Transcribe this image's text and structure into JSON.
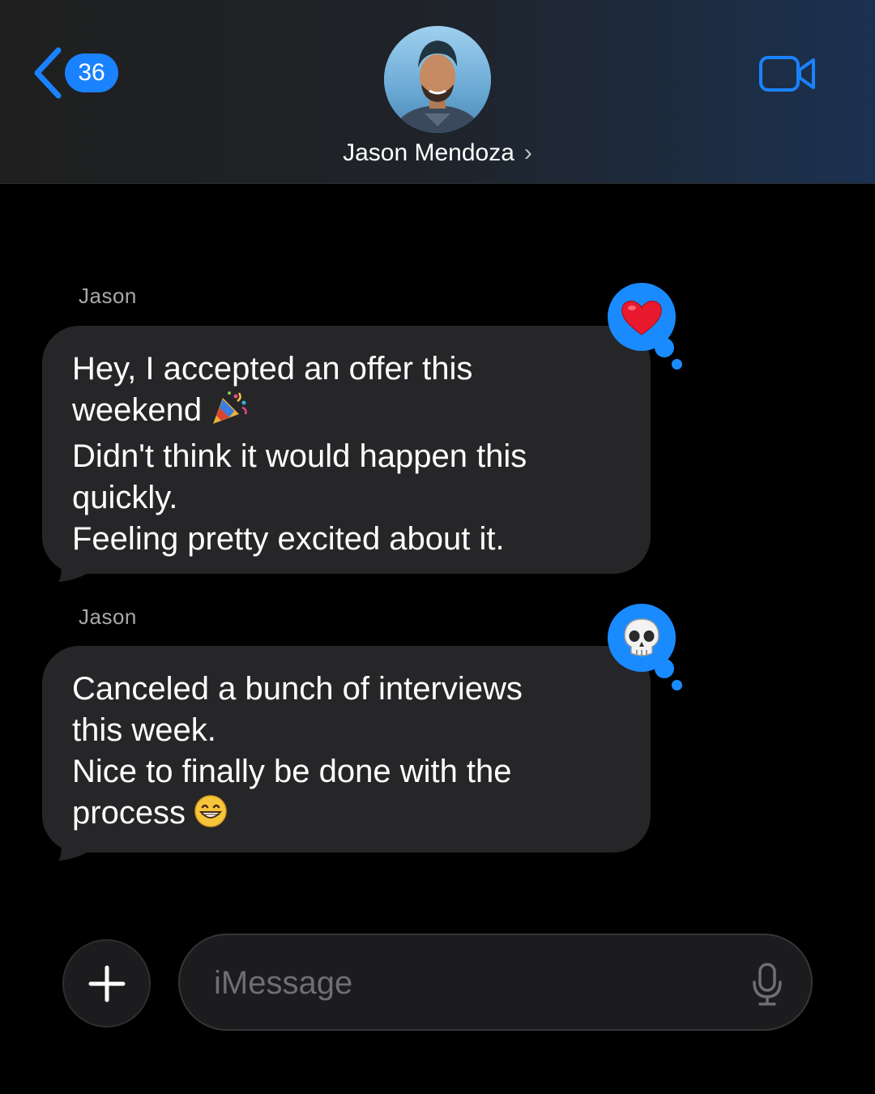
{
  "header": {
    "back_badge": "36",
    "contact_name": "Jason Mendoza",
    "contact_chevron": "›"
  },
  "messages": [
    {
      "sender": "Jason",
      "lines": [
        "Hey, I accepted an offer this",
        "weekend",
        "Didn't think it would happen this",
        "quickly.",
        "Feeling pretty excited about it."
      ],
      "inline_emoji": "party-popper",
      "reaction": "❤️",
      "reaction_name": "heart"
    },
    {
      "sender": "Jason",
      "lines": [
        "Canceled a bunch of interviews",
        "this week.",
        "Nice to finally be done with the",
        "process"
      ],
      "inline_emoji": "grinning-face",
      "reaction": "💀",
      "reaction_name": "skull"
    }
  ],
  "composer": {
    "placeholder": "iMessage",
    "plus_label": "+"
  },
  "colors": {
    "accent": "#1a82ff",
    "bubble": "#262628",
    "background": "#000000"
  },
  "icons": {
    "back": "chevron-left-icon",
    "video": "video-camera-icon",
    "plus": "plus-icon",
    "mic": "microphone-icon"
  }
}
